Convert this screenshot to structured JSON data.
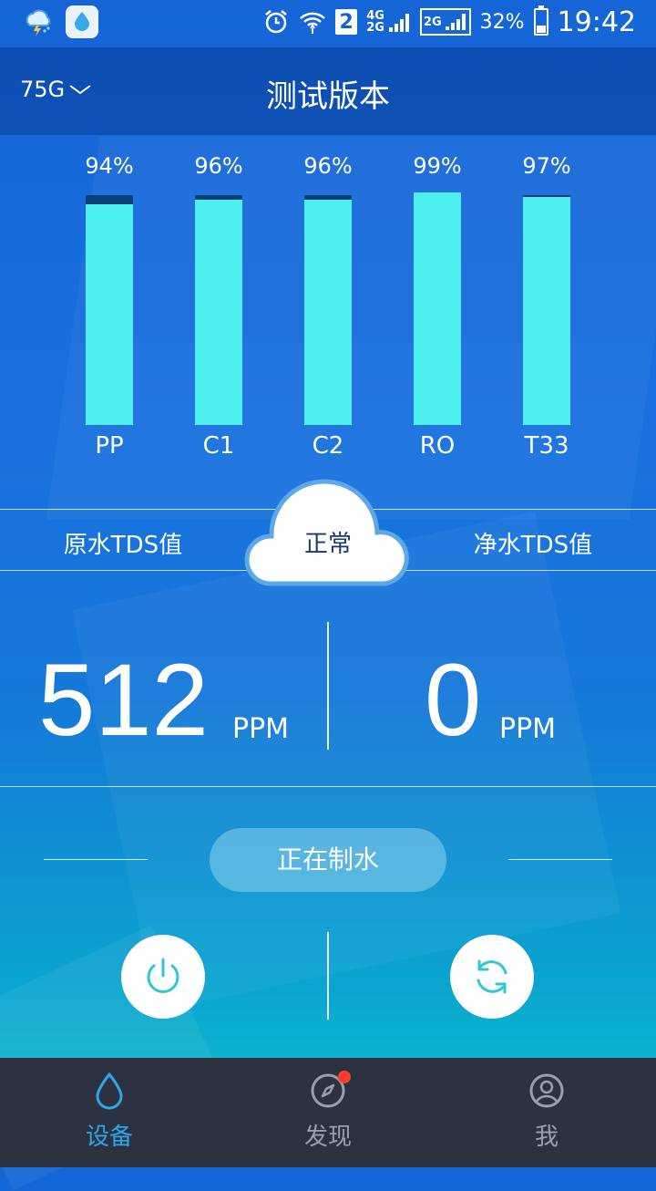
{
  "status_bar": {
    "signal_labels": [
      "4G",
      "2G",
      "2G"
    ],
    "sim": "2",
    "battery_percent": "32%",
    "time": "19:42"
  },
  "header": {
    "device": "75G",
    "title": "测试版本"
  },
  "filters": [
    {
      "name": "PP",
      "percent_label": "94%",
      "level": 0.94
    },
    {
      "name": "C1",
      "percent_label": "96%",
      "level": 0.96
    },
    {
      "name": "C2",
      "percent_label": "96%",
      "level": 0.96
    },
    {
      "name": "RO",
      "percent_label": "99%",
      "level": 0.99
    },
    {
      "name": "T33",
      "percent_label": "97%",
      "level": 0.97
    }
  ],
  "tds": {
    "raw_label": "原水TDS值",
    "pure_label": "净水TDS值",
    "status": "正常",
    "raw_value": "512",
    "raw_unit": "PPM",
    "pure_value": "0",
    "pure_unit": "PPM"
  },
  "production_status": "正在制水",
  "controls": {
    "power_icon": "power-icon",
    "refresh_icon": "refresh-icon"
  },
  "nav": [
    {
      "label": "设备",
      "icon": "drop-icon",
      "active": true
    },
    {
      "label": "发现",
      "icon": "compass-icon",
      "badge": true
    },
    {
      "label": "我",
      "icon": "profile-icon"
    }
  ],
  "colors": {
    "accent": "#2ea6e8",
    "filter_fill": "#4df0ee",
    "nav_bg": "#2c3240",
    "badge": "#ff3b30"
  }
}
